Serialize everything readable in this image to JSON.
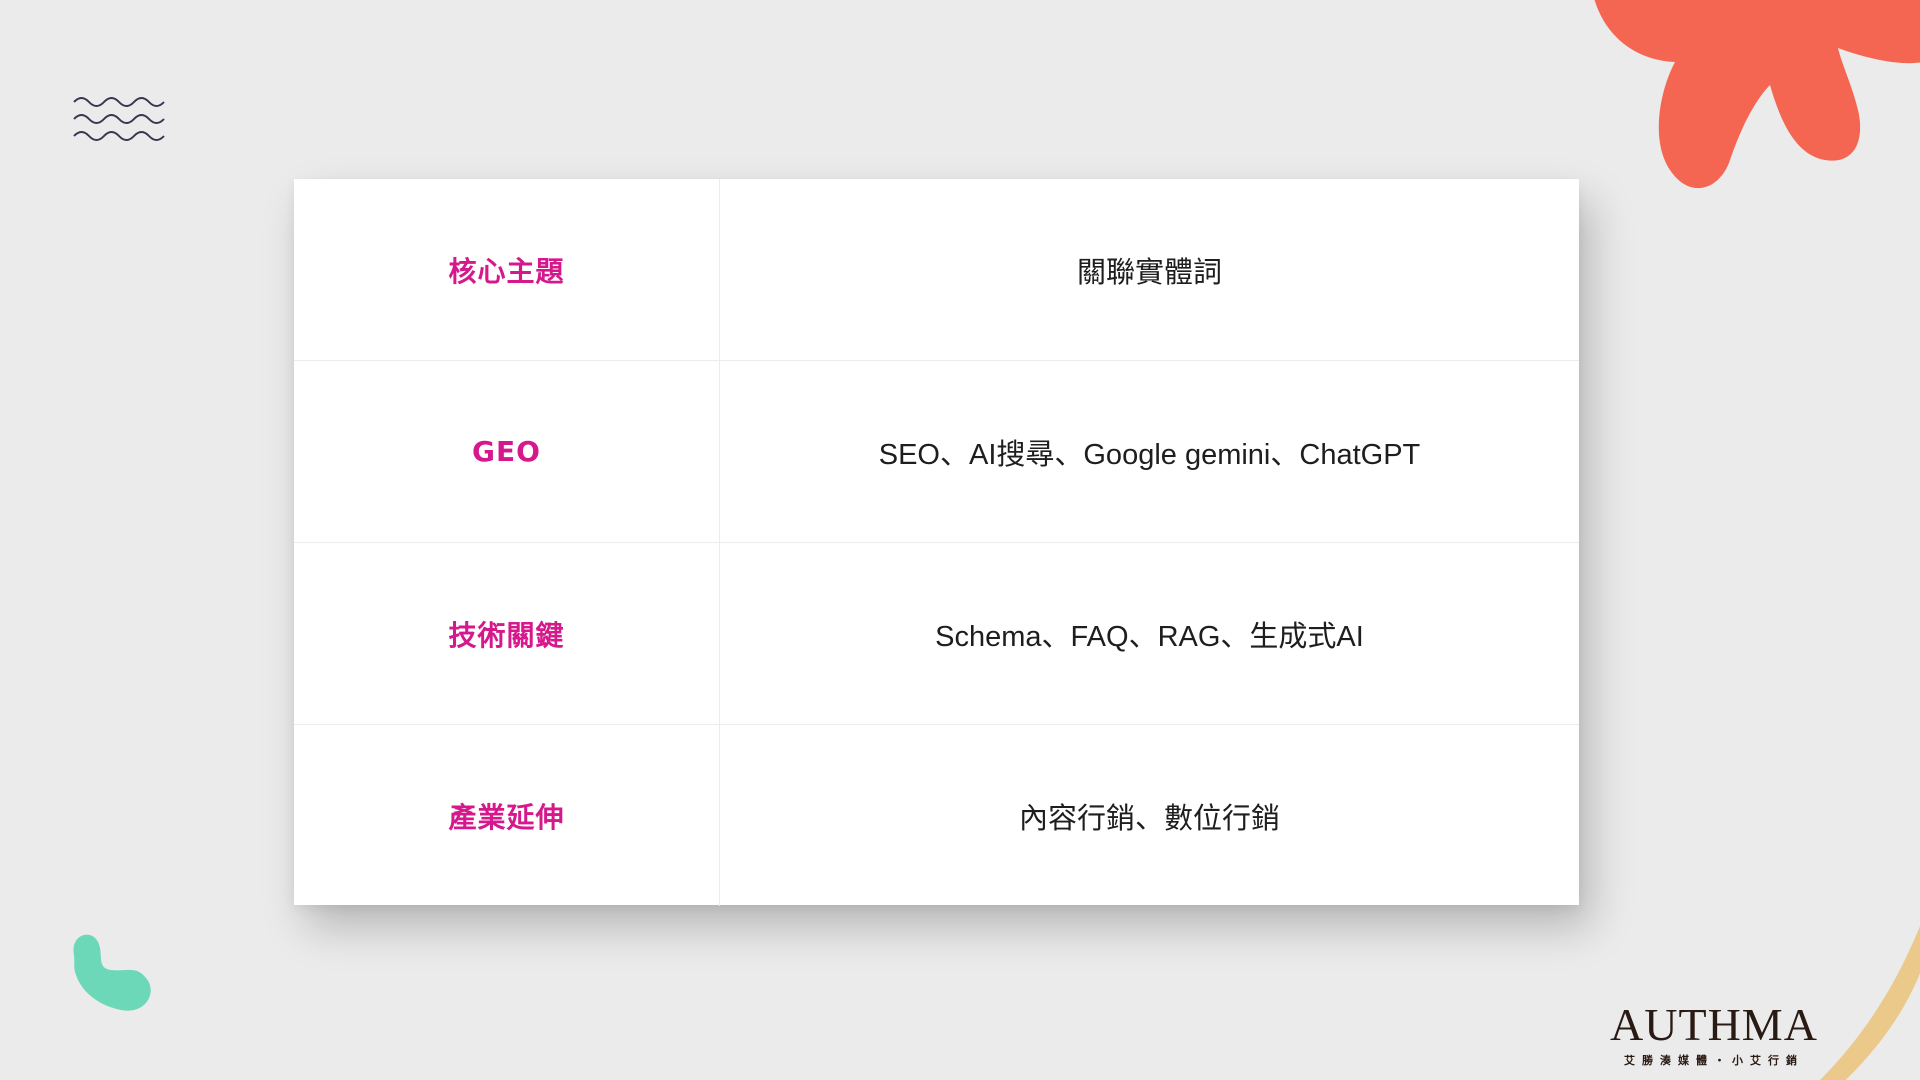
{
  "table": {
    "rows": [
      {
        "key": "核心主題",
        "value": "關聯實體詞"
      },
      {
        "key": "GEO",
        "value": "SEO、AI搜尋、Google gemini、ChatGPT"
      },
      {
        "key": "技術關鍵",
        "value": "Schema、FAQ、RAG、生成式AI"
      },
      {
        "key": "產業延伸",
        "value": "內容行銷、數位行銷"
      }
    ]
  },
  "brand": {
    "name": "AUTHMA",
    "tagline": "艾勝湊媒體・小艾行銷"
  },
  "colors": {
    "background": "#ebebeb",
    "key_text": "#d6188d",
    "coral": "#f46651",
    "mint": "#6cd8b8",
    "sand": "#ebc98a",
    "wave": "#3a3550"
  },
  "decorations": [
    "wave-lines-icon",
    "coral-blob-icon",
    "mint-blob-icon",
    "sand-arc-icon"
  ]
}
